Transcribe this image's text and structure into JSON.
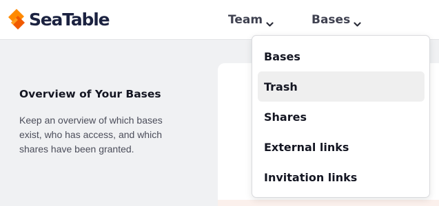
{
  "brand": {
    "name": "SeaTable",
    "accent": "#ff8000",
    "accent_dark": "#e05a00",
    "text_color": "#1b2240"
  },
  "nav": {
    "team": {
      "label": "Team",
      "icon": "chevron-down-icon"
    },
    "bases": {
      "label": "Bases",
      "icon": "chevron-down-icon"
    }
  },
  "intro": {
    "title": "Overview of Your Bases",
    "text": "Keep an overview of which bases exist, who has access, and which shares have been granted."
  },
  "dropdown": {
    "items": [
      {
        "label": "Bases",
        "highlighted": false
      },
      {
        "label": "Trash",
        "highlighted": true
      },
      {
        "label": "Shares",
        "highlighted": false
      },
      {
        "label": "External links",
        "highlighted": false
      },
      {
        "label": "Invitation links",
        "highlighted": false
      }
    ]
  }
}
